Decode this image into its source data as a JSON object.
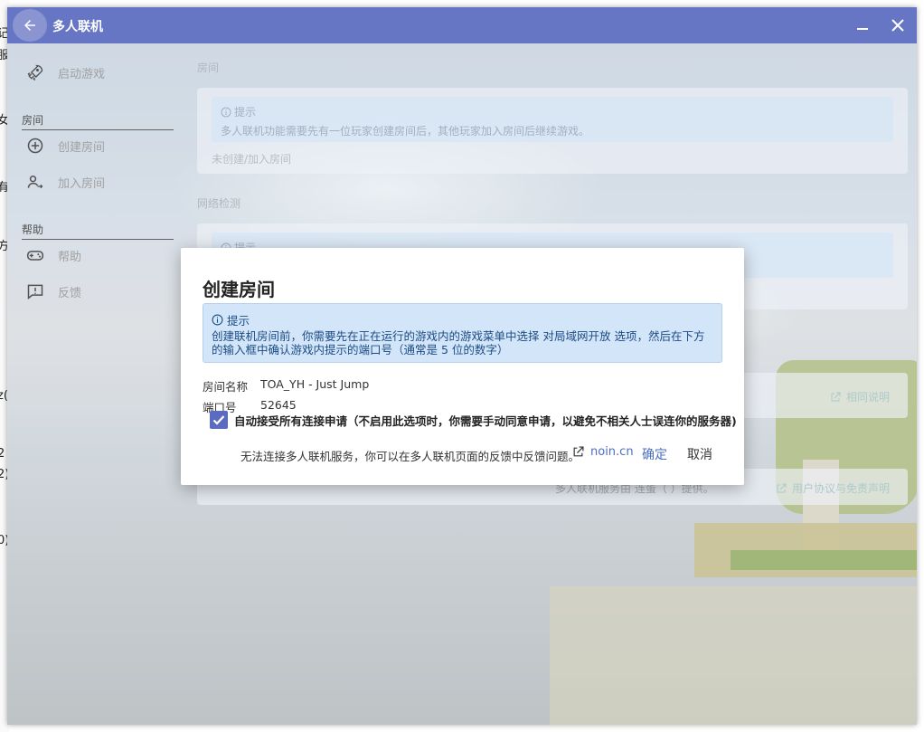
{
  "window": {
    "title": "多人联机"
  },
  "sidebar": {
    "launch": "启动游戏",
    "room_header": "房间",
    "create_room": "创建房间",
    "join_room": "加入房间",
    "help_header": "帮助",
    "help": "帮助",
    "feedback": "反馈"
  },
  "main": {
    "room_section": "房间",
    "tip_label": "提示",
    "tip_text": "多人联机功能需要先有一位玩家创建房间后，其他玩家加入房间后继续游戏。",
    "room_status": "未创建/加入房间",
    "network_section": "网络检测",
    "network_tip_label": "提示",
    "side_link": "相同说明",
    "footer_provided": "多人联机服务由 连蛋（              ）提供。",
    "footer_link": "用户协议与免责声明"
  },
  "dialog": {
    "title": "创建房间",
    "tip_label": "提示",
    "tip_text": "创建联机房间前，你需要先在正在运行的游戏内的游戏菜单中选择 对局域网开放 选项，然后在下方的输入框中确认游戏内提示的端口号（通常是 5 位的数字）",
    "room_name_label": "房间名称",
    "room_name_value": "TOA_YH - Just Jump",
    "port_label": "端口号",
    "port_value": "52645",
    "auto_accept_label": "自动接受所有连接申请（不启用此选项时，你需要手动同意申请，以避免不相关人士误连你的服务器)",
    "auto_accept_checked": true,
    "footer_message": "无法连接多人联机服务，你可以在多人联机页面的反馈中反馈问题。",
    "footer_link": "noin.cn",
    "ok": "确定",
    "cancel": "取消"
  },
  "colors": {
    "accent": "#5b6bbf",
    "tip_bg": "#d3e6f9",
    "tip_text": "#1c4b86",
    "link": "#4a6fc4"
  },
  "behind_glyphs": [
    "记",
    "服",
    "女",
    "有",
    "方",
    "z(",
    "2",
    "2)",
    "0)"
  ]
}
